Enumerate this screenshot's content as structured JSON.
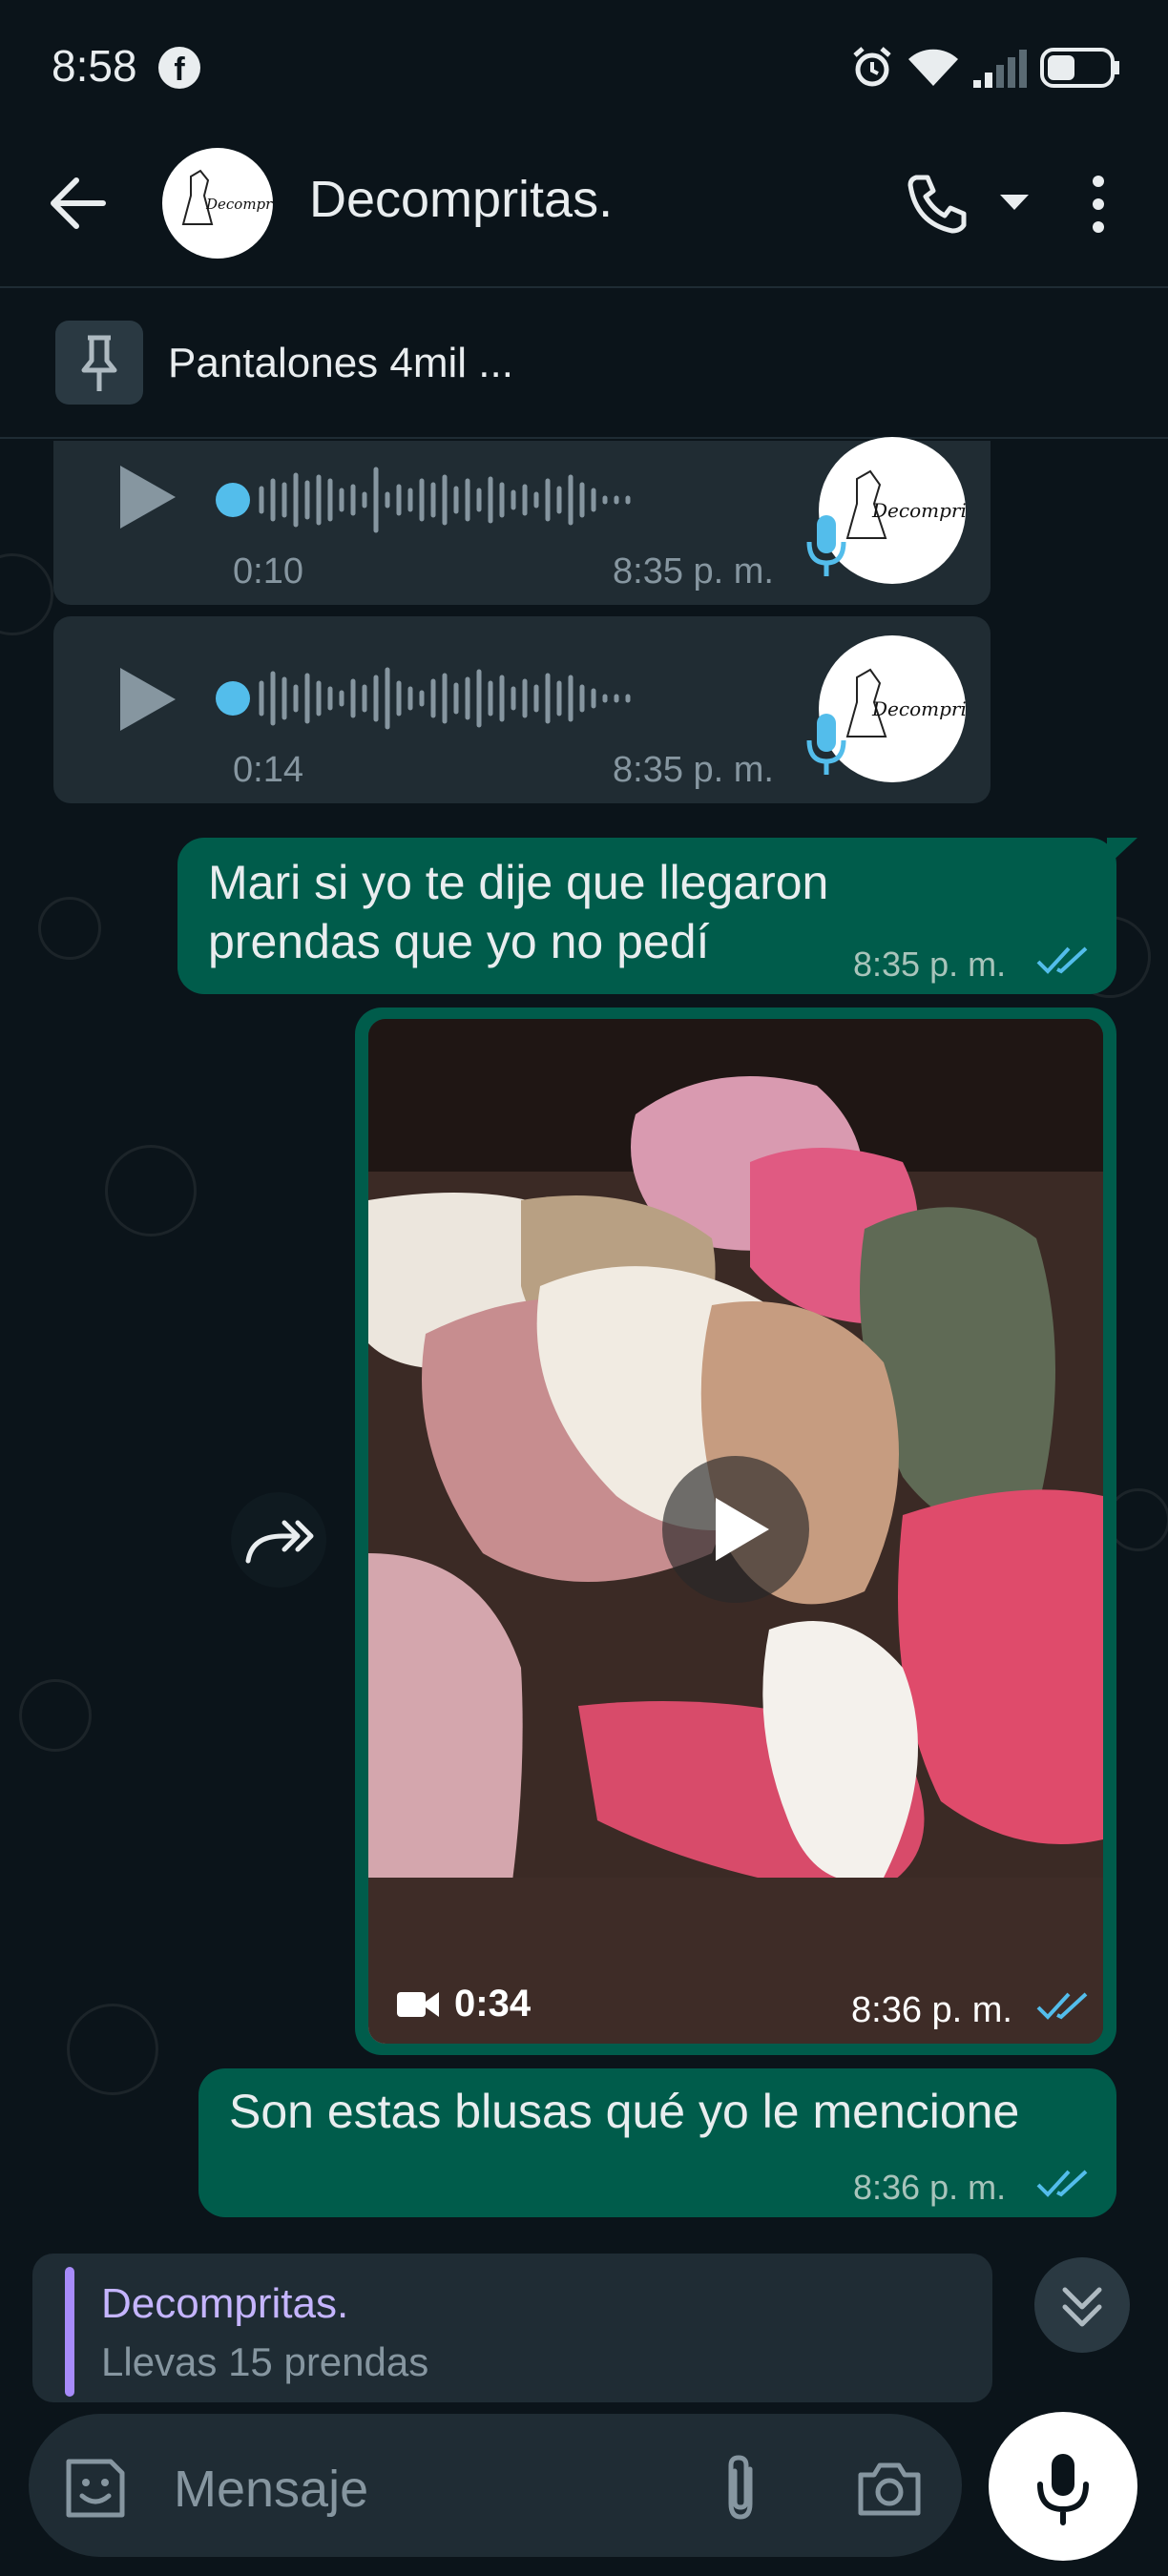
{
  "status": {
    "time": "8:58",
    "fb": "f"
  },
  "header": {
    "contact_name": "Decompritas.",
    "avatar_text": "Decompritas"
  },
  "pinned": {
    "text": "Pantalones 4mil ..."
  },
  "messages": {
    "voice1": {
      "duration": "0:10",
      "time": "8:35 p. m."
    },
    "voice2": {
      "duration": "0:14",
      "time": "8:35 p. m."
    },
    "text1": {
      "line1": "Mari si yo te dije que llegaron",
      "line2": "prendas que yo no pedí",
      "time": "8:35 p. m."
    },
    "video": {
      "duration": "0:34",
      "time": "8:36 p. m."
    },
    "text2": {
      "text": "Son estas blusas qué yo le mencione",
      "time": "8:36 p. m."
    }
  },
  "reply": {
    "name": "Decompritas.",
    "text": "Llevas 15 prendas"
  },
  "composer": {
    "placeholder": "Mensaje"
  },
  "colors": {
    "bg": "#0b141a",
    "incoming": "#202c33",
    "outgoing": "#005c4b",
    "accent": "#53bdeb"
  }
}
